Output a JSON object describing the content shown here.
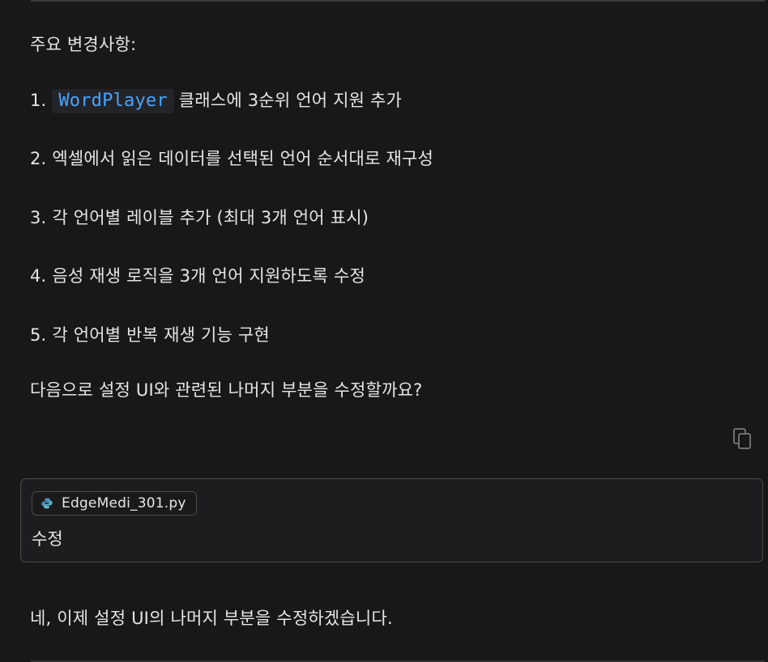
{
  "message": {
    "heading": "주요 변경사항:",
    "items": [
      {
        "num": "1.",
        "code": "WordPlayer",
        "text": "클래스에 3순위 언어 지원 추가"
      },
      {
        "num": "2.",
        "text": "엑셀에서 읽은 데이터를 선택된 언어 순서대로 재구성"
      },
      {
        "num": "3.",
        "text": "각 언어별 레이블 추가 (최대 3개 언어 표시)"
      },
      {
        "num": "4.",
        "text": "음성 재생 로직을 3개 언어 지원하도록 수정"
      },
      {
        "num": "5.",
        "text": "각 언어별 반복 재생 기능 구현"
      }
    ],
    "question": "다음으로 설정 UI와 관련된 나머지 부분을 수정할까요?"
  },
  "copy_icon": "copy-icon",
  "user_message": {
    "file_chip": {
      "icon": "python-icon",
      "label": "EdgeMedi_301.py"
    },
    "text": "수정"
  },
  "reply": {
    "text": "네, 이제 설정 UI의 나머지 부분을 수정하겠습니다."
  },
  "colors": {
    "background": "#181818",
    "text": "#e6e6e6",
    "code_text": "#4aa3ff",
    "code_bg": "#232427",
    "border": "#4a4a4a"
  }
}
